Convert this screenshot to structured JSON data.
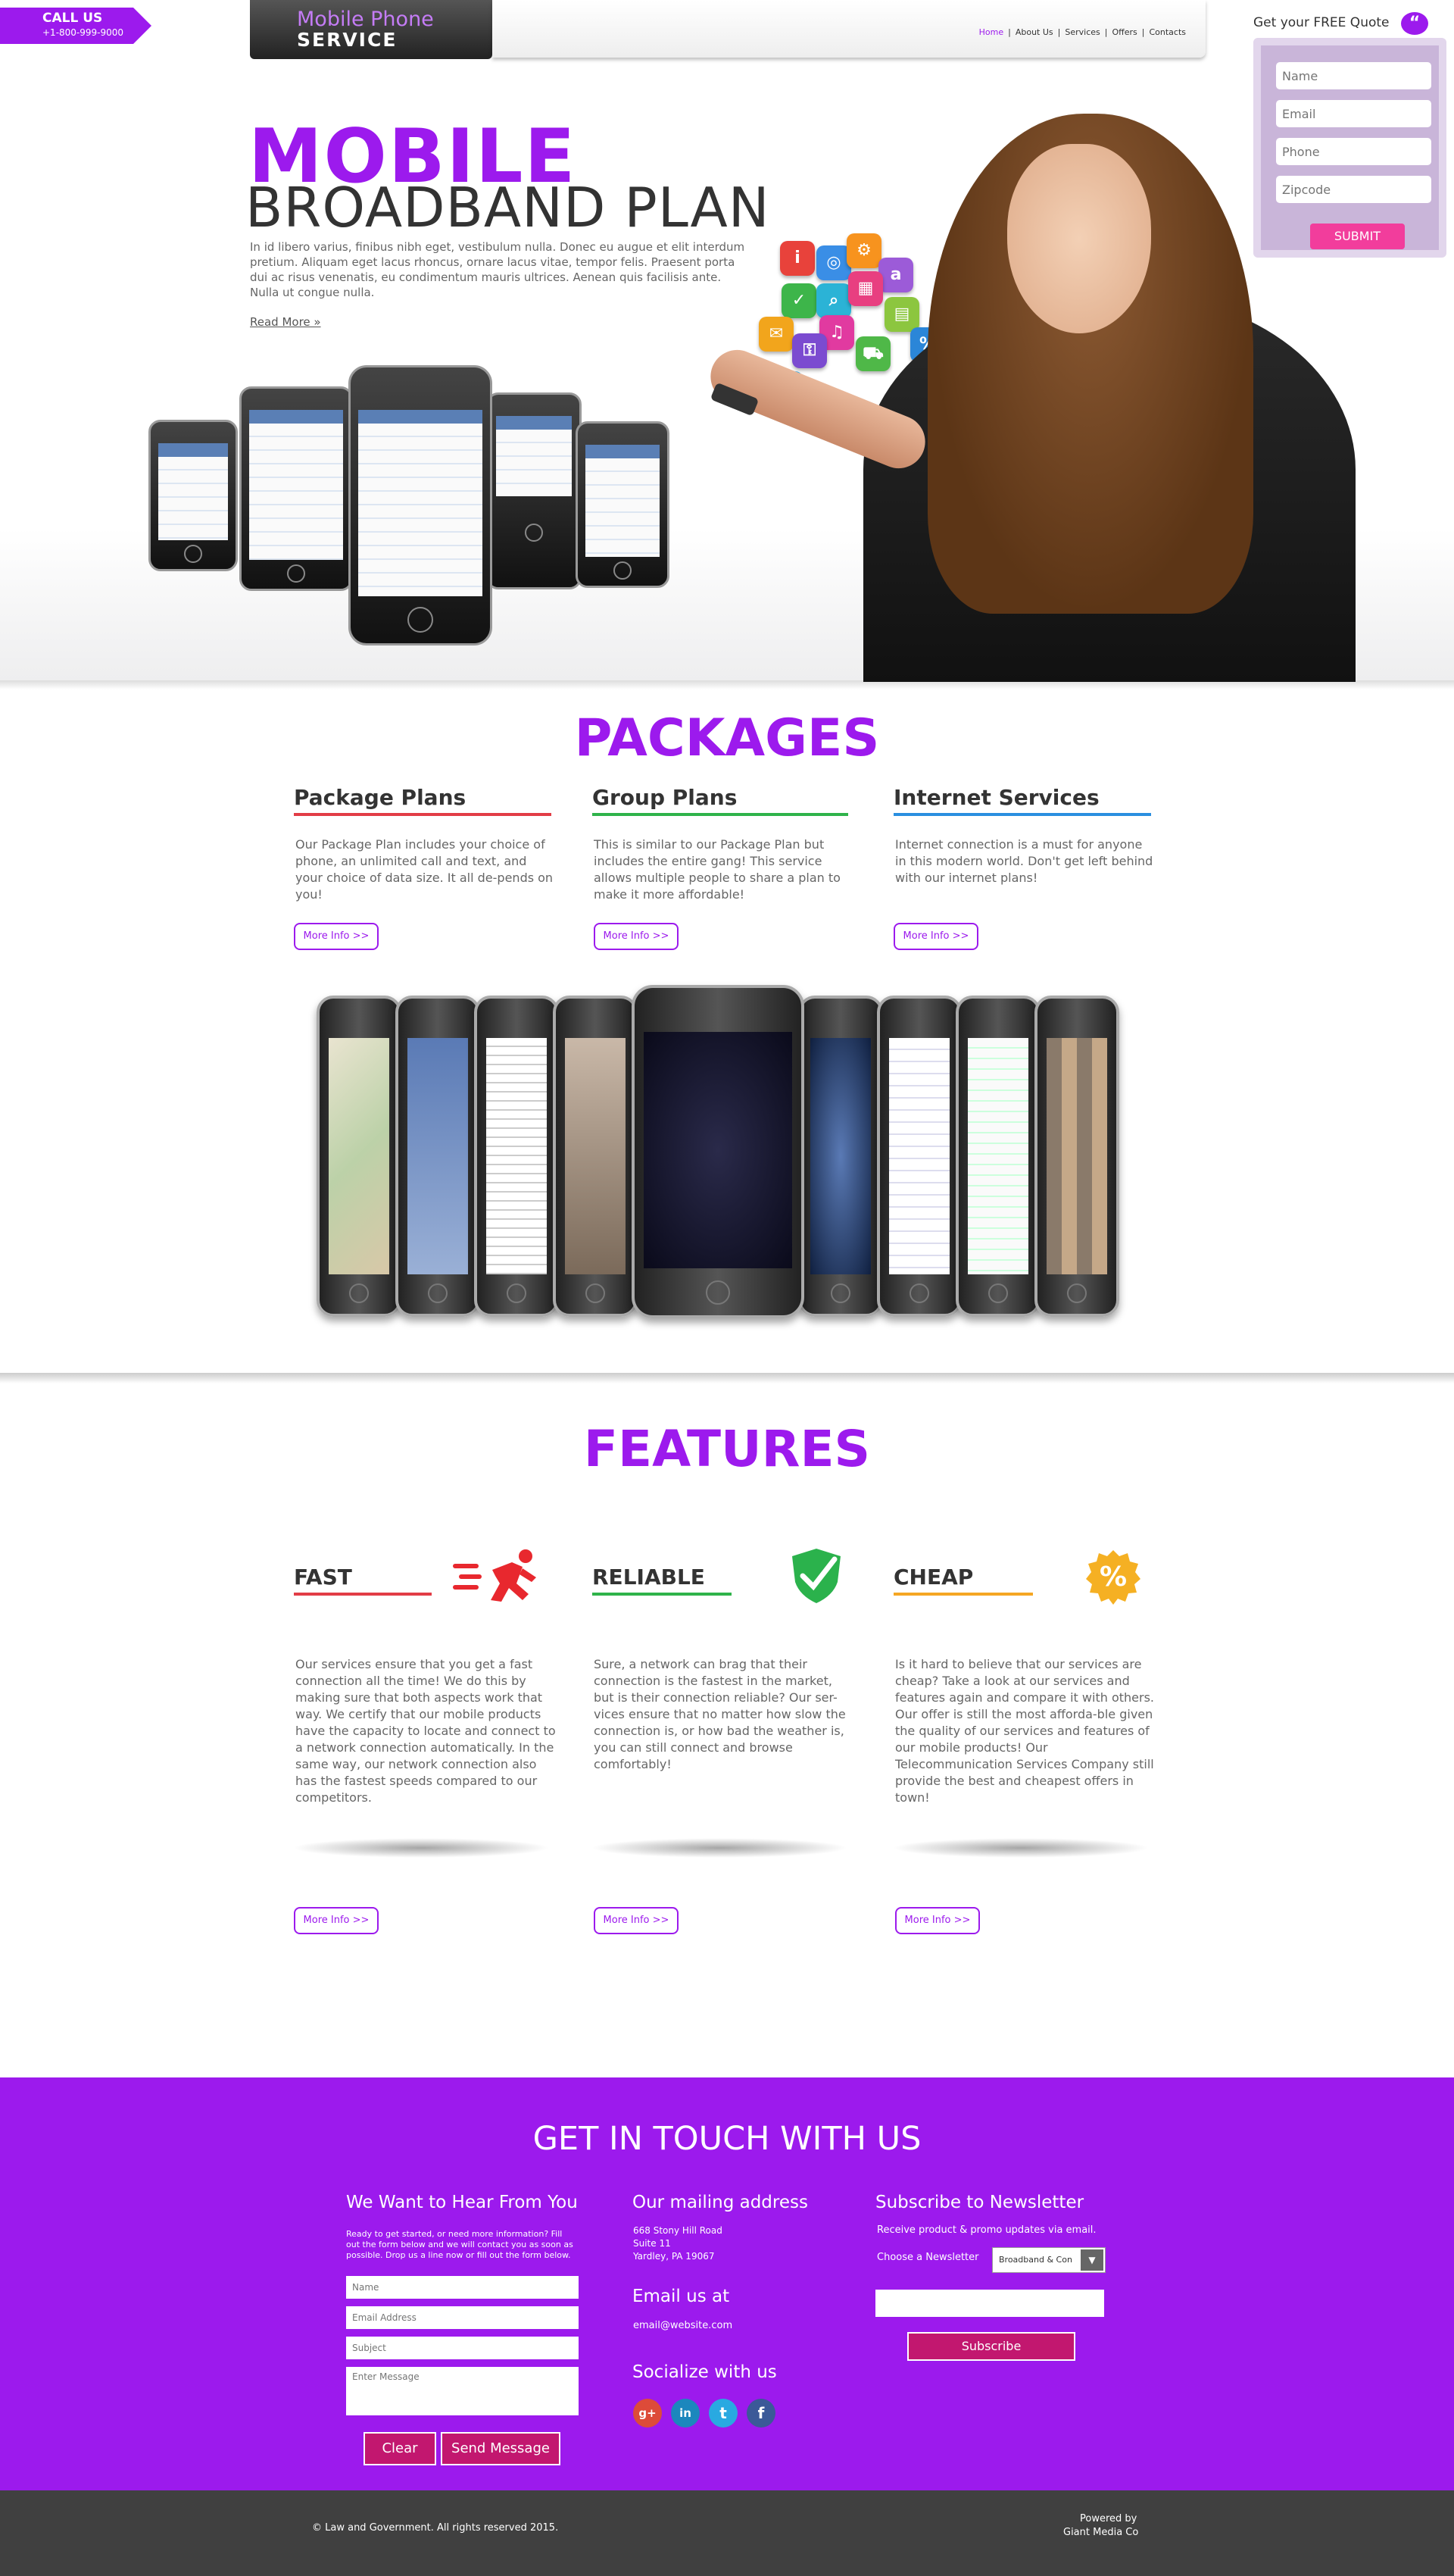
{
  "header": {
    "callus_label": "CALL US",
    "phone": "+1-800-999-9000",
    "logo_line1": "Mobile Phone",
    "logo_line2": "SERVICE",
    "nav": [
      "Home",
      "About Us",
      "Services",
      "Offers",
      "Contacts"
    ],
    "nav_separator": "|"
  },
  "quote": {
    "title": "Get your FREE Quote",
    "bubble": "“",
    "name_placeholder": "Name",
    "email_placeholder": "Email",
    "phone_placeholder": "Phone",
    "zip_placeholder": "Zipcode",
    "submit": "SUBMIT"
  },
  "hero": {
    "title_line1": "MOBILE",
    "title_line2": "BROADBAND PLAN",
    "text": "In id libero varius, finibus nibh eget, vestibulum nulla. Donec eu augue et elit interdum pretium. Aliquam eget lacus rhoncus, ornare lacus vitae, tempor felis. Praesent porta dui ac risus venenatis, eu condimentum mauris ultrices. Aenean quis facilisis ante. Nulla ut congue nulla.",
    "read_more": "Read More »"
  },
  "packages": {
    "title": "PACKAGES",
    "columns": [
      {
        "heading": "Package Plans",
        "text": "Our Package Plan includes your choice of phone, an unlimited call and text, and your choice of data size. It all de-pends on you!",
        "more": "More Info >>",
        "color": "#e23d46"
      },
      {
        "heading": "Group Plans",
        "text": "This is similar to our Package Plan but includes the entire gang! This service allows multiple people to share a plan to make it more affordable!",
        "more": "More Info >>",
        "color": "#2fb34a"
      },
      {
        "heading": "Internet Services",
        "text": "Internet connection is a must for anyone in this modern world. Don't get left behind with our internet plans!",
        "more": "More Info >>",
        "color": "#2a8fe0"
      }
    ]
  },
  "features": {
    "title": "FEATURES",
    "columns": [
      {
        "heading": "FAST",
        "text": "Our services ensure that you get a fast connection all the time! We do this by making sure that both aspects work that way. We certify that our mobile products have the capacity to locate and connect to a network connection automatically. In the same way, our network connection also has the fastest speeds compared to our competitors.",
        "more": "More Info >>",
        "color": "#e23d46",
        "icon": "running-man-icon"
      },
      {
        "heading": "RELIABLE",
        "text": "Sure, a network can brag that their connection is the fastest in the market, but is their connection reliable? Our ser-vices ensure that no matter how slow the connection is, or how bad the weather is, you can still connect and browse comfortably!",
        "more": "More Info >>",
        "color": "#2fb34a",
        "icon": "shield-check-icon"
      },
      {
        "heading": "CHEAP",
        "text": "Is it hard to believe that our services are cheap? Take a look at our services and features again and compare it with others. Our offer is still the most afforda-ble given the quality of our services and features of our mobile products! Our Telecommunication Services Company still provide the best and cheapest offers in town!",
        "more": "More Info >>",
        "color": "#f5a623",
        "icon": "percent-badge-icon",
        "icon_text": "%"
      }
    ]
  },
  "contact": {
    "title": "GET IN TOUCH WITH US",
    "form_heading": "We Want to Hear From You",
    "form_intro": "Ready to get started, or need more information? Fill out the form below and we will contact you as soon as possible. Drop us a line now or fill out the form below.",
    "name_placeholder": "Name",
    "email_placeholder": "Email Address",
    "subject_placeholder": "Subject",
    "message_placeholder": "Enter Message",
    "clear": "Clear",
    "send": "Send Message",
    "mailing_heading": "Our mailing address",
    "address_line1": "668 Stony Hill Road",
    "address_line2": "Suite 11",
    "address_line3": "Yardley, PA 19067",
    "email_heading": "Email us at",
    "email": "email@website.com",
    "social_heading": "Socialize with us",
    "social": [
      {
        "icon": "google-plus-icon",
        "glyph": "g+",
        "color": "#dd4b39"
      },
      {
        "icon": "linkedin-icon",
        "glyph": "in",
        "color": "#1c87bd"
      },
      {
        "icon": "twitter-icon",
        "glyph": "t",
        "color": "#29a9e1"
      },
      {
        "icon": "facebook-icon",
        "glyph": "f",
        "color": "#3b5998"
      }
    ],
    "newsletter_heading": "Subscribe to Newsletter",
    "newsletter_text": "Receive product & promo updates via email.",
    "choose_label": "Choose a Newsletter",
    "choose_value": "Broadband & Con",
    "subscribe": "Subscribe"
  },
  "footer": {
    "copyright": "© Law and Government. All rights reserved 2015.",
    "powered_line1": "Powered by",
    "powered_line2": "Giant Media Co"
  },
  "colors": {
    "brand": "#9c1aed",
    "accent": "#f23d9c",
    "footer": "#404040"
  }
}
